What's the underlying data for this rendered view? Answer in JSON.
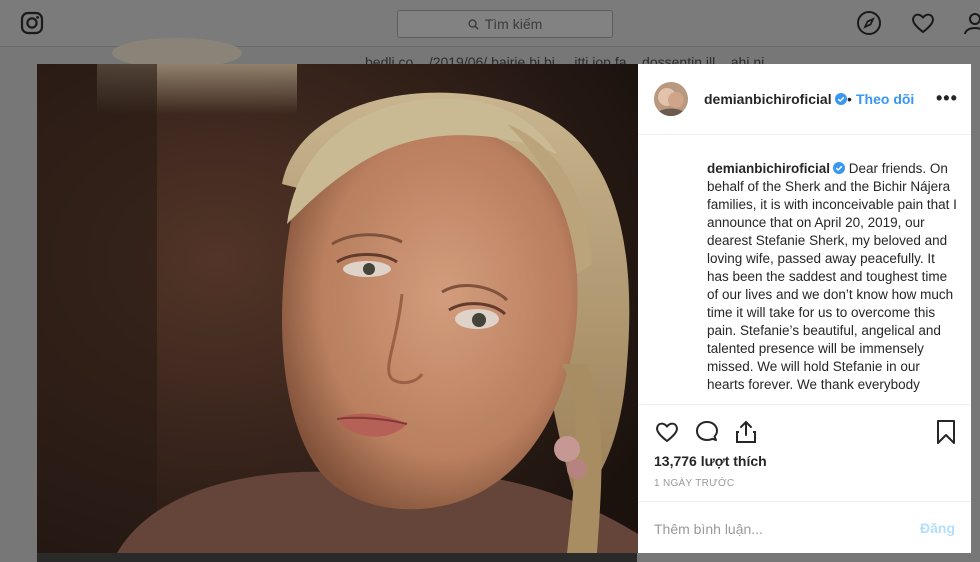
{
  "topbar": {
    "logo_icon": "instagram-icon",
    "search_placeholder": "Tìm kiếm",
    "nav_icons": [
      "compass-icon",
      "heart-icon",
      "user-icon"
    ]
  },
  "background": {
    "strip_text": "bedli co... /2019/06/ bairie bi bi ... itti iop fa... dossentin.ill... ahi.ni..."
  },
  "post": {
    "username": "demianbichiroficial",
    "verified": true,
    "dot": "•",
    "follow_label": "Theo dõi",
    "more_label": "•••",
    "caption_username": "demianbichiroficial",
    "caption_text": "Dear friends. On behalf of the Sherk and the Bichir Nájera families, it is with inconceivable pain that I announce that on April 20, 2019, our dearest Stefanie Sherk, my beloved and loving wife, passed away peacefully. It has been the saddest and toughest time of our lives and we don’t know how much time it will take for us to overcome this pain. Stefanie’s beautiful, angelical and talented presence will be immensely missed. We will hold Stefanie in our hearts forever. We thank everybody",
    "likes_text": "13,776 lượt thích",
    "time_text": "1 NGÀY TRƯỚC",
    "comment_placeholder": "Thêm bình luận...",
    "post_button": "Đăng"
  },
  "colors": {
    "accent": "#3897f0",
    "post_disabled": "#b2dffc",
    "overlay": "#777777"
  }
}
